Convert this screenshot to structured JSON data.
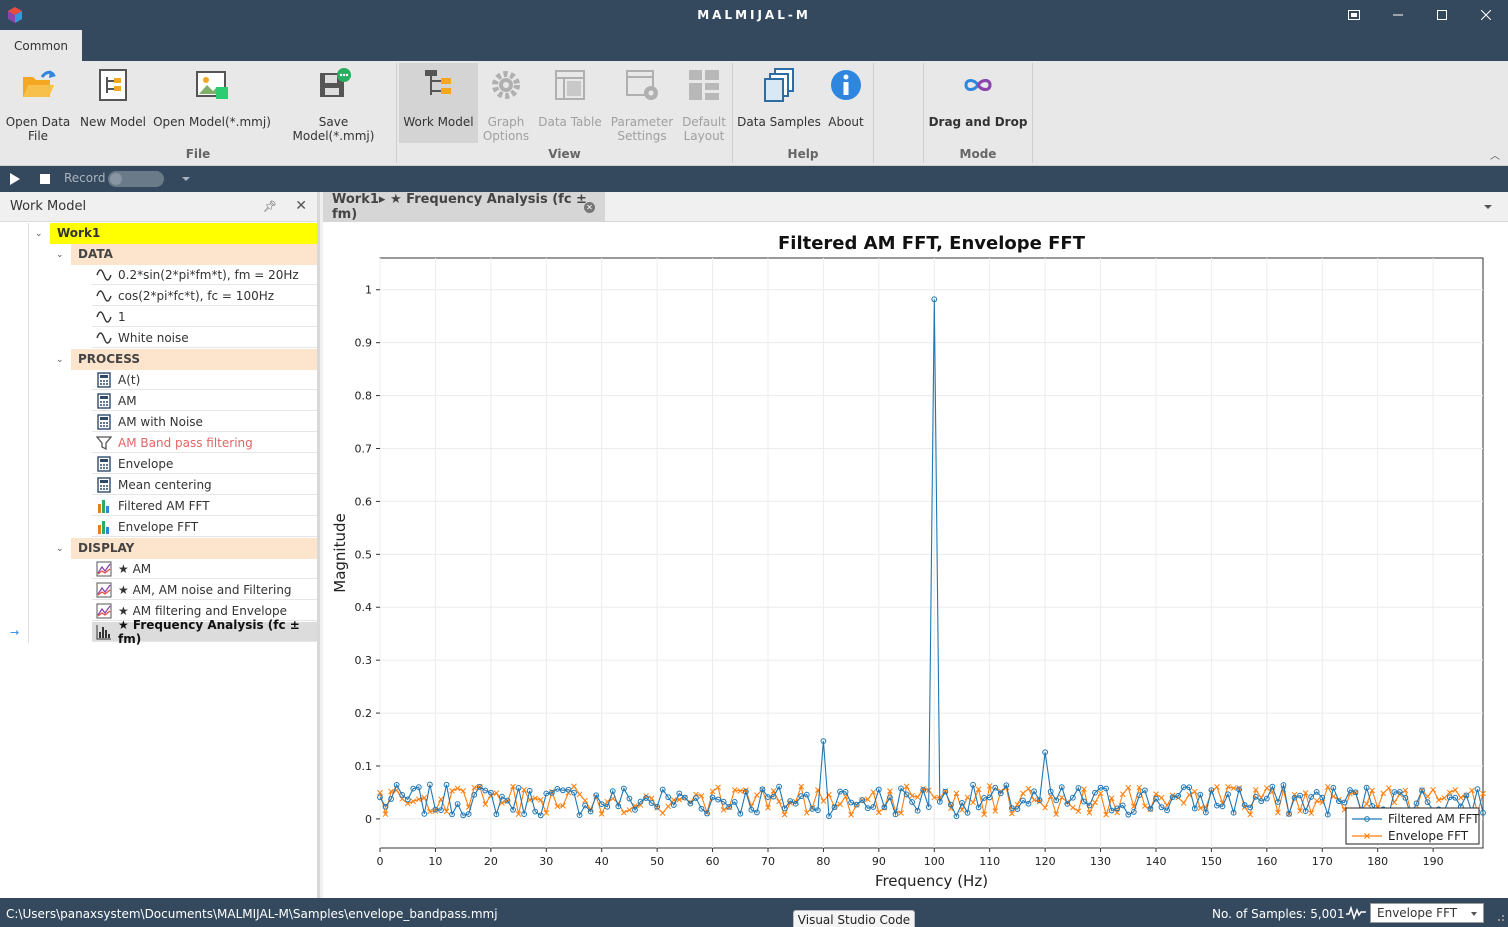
{
  "window": {
    "title": "MALMIJAL-M",
    "controls": [
      "restore-layout",
      "minimize",
      "maximize",
      "close"
    ]
  },
  "ribbon": {
    "tab": "Common",
    "groups": {
      "file": "File",
      "view": "View",
      "help": "Help",
      "mode": "Mode"
    },
    "buttons": {
      "open_data_line1": "Open Data",
      "open_data_line2": "File",
      "new_model": "New Model",
      "open_model": "Open Model(*.mmj)",
      "save_model": "Save Model(*.mmj)",
      "work_model": "Work Model",
      "graph_options_line1": "Graph",
      "graph_options_line2": "Options",
      "data_table": "Data Table",
      "param_settings_line1": "Parameter",
      "param_settings_line2": "Settings",
      "default_layout_line1": "Default",
      "default_layout_line2": "Layout",
      "data_samples": "Data Samples",
      "about": "About",
      "drag_drop": "Drag and Drop"
    }
  },
  "recordbar": {
    "record_label": "Record"
  },
  "workmodel": {
    "title": "Work Model",
    "root": "Work1",
    "sections": {
      "data": "DATA",
      "process": "PROCESS",
      "display": "DISPLAY"
    },
    "data_items": [
      "0.2*sin(2*pi*fm*t), fm = 20Hz",
      "cos(2*pi*fc*t), fc = 100Hz",
      "1",
      "White noise"
    ],
    "process_items": [
      "A(t)",
      "AM",
      "AM with Noise",
      "AM Band pass filtering",
      "Envelope",
      "Mean centering",
      "Filtered AM FFT",
      "Envelope FFT"
    ],
    "display_items": [
      "★ AM",
      "★ AM, AM noise and Filtering",
      "★ AM filtering and Envelope",
      "★ Frequency Analysis (fc ± fm)"
    ]
  },
  "doctab": {
    "label": "Work1▸ ★ Frequency Analysis (fc ± fm)"
  },
  "chart_data": {
    "type": "line",
    "title": "Filtered AM FFT, Envelope FFT",
    "xlabel": "Frequency (Hz)",
    "ylabel": "Magnitude",
    "xlim": [
      0,
      199
    ],
    "ylim": [
      -0.055,
      1.06
    ],
    "xticks": [
      0,
      10,
      20,
      30,
      40,
      50,
      60,
      70,
      80,
      90,
      100,
      110,
      120,
      130,
      140,
      150,
      160,
      170,
      180,
      190
    ],
    "yticks": [
      0,
      0.1,
      0.2,
      0.3,
      0.4,
      0.5,
      0.6,
      0.7,
      0.8,
      0.9,
      1
    ],
    "grid": true,
    "legend_position": "bottom-right",
    "series": [
      {
        "name": "Filtered AM FFT",
        "color": "#1f77b4",
        "marker": "circle",
        "peaks": [
          [
            80,
            0.147
          ],
          [
            100,
            0.982
          ],
          [
            120,
            0.126
          ]
        ],
        "baseline_approx": 0.035,
        "x_step": 1
      },
      {
        "name": "Envelope FFT",
        "color": "#ff7f0e",
        "marker": "x",
        "baseline_approx": 0.035,
        "x_step": 1
      }
    ]
  },
  "status": {
    "path": "C:\\Users\\panaxsystem\\Documents\\MALMIJAL-M\\Samples\\envelope_bandpass.mmj",
    "samples": "No. of Samples: 5,001",
    "selected_series": "Envelope FFT",
    "tooltip": "Visual Studio Code"
  }
}
